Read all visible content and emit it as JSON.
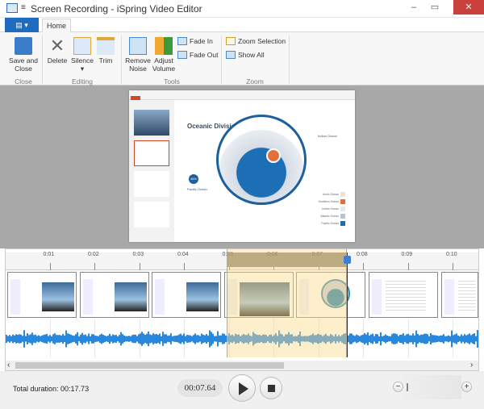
{
  "window": {
    "title": "Screen Recording - iSpring Video Editor",
    "minimize": "–",
    "maximize": "▭",
    "close": "✕",
    "close_color": "#c9403d"
  },
  "tabs": {
    "file_label": "▤ ▾",
    "home": "Home"
  },
  "ribbon": {
    "groups": [
      {
        "label": "Close",
        "buttons": [
          {
            "label": "Save and Close",
            "icon": "save-icon"
          }
        ]
      },
      {
        "label": "Editing",
        "buttons": [
          {
            "label": "Delete",
            "icon": "delete-icon"
          },
          {
            "label": "Silence",
            "icon": "silence-icon",
            "dropdown": "▾"
          },
          {
            "label": "Trim",
            "icon": "trim-icon"
          }
        ]
      },
      {
        "label": "Tools",
        "buttons": [
          {
            "label": "Remove Noise",
            "icon": "remove-noise-icon"
          },
          {
            "label": "Adjust Volume",
            "icon": "volume-icon"
          },
          {
            "label": "Fade In",
            "icon": "fade-in-icon"
          },
          {
            "label": "Fade Out",
            "icon": "fade-out-icon"
          }
        ]
      },
      {
        "label": "Zoom",
        "buttons": [
          {
            "label": "Zoom Selection",
            "icon": "zoom-selection-icon"
          },
          {
            "label": "Show All",
            "icon": "show-all-icon"
          }
        ]
      }
    ]
  },
  "preview": {
    "slide_title": "Oceanic Divisions",
    "callout_left": "Pacific Ocean",
    "callout_right": "Indian Ocean",
    "badge": "46%",
    "legend": [
      "Arctic Ocean",
      "Southern Ocean",
      "Indian Ocean",
      "Atlantic Ocean",
      "Pacific Ocean"
    ],
    "legend_colors": [
      "#f1e1cf",
      "#e2703e",
      "#e6e9ee",
      "#b9c4d2",
      "#1c6fb4"
    ]
  },
  "timeline": {
    "ticks": [
      "0:01",
      "0:02",
      "0:03",
      "0:04",
      "0:05",
      "0:06",
      "0:07",
      "0:08",
      "0:09",
      "0:10"
    ],
    "selection_start_sec": 4.95,
    "selection_end_sec": 7.64,
    "playhead_sec": 7.64,
    "waveform_color": "#2a88dc",
    "scroll_left": "‹",
    "scroll_right": "›",
    "scroll_position": 0.58
  },
  "footer": {
    "total_duration": "Total duration: 00:17.73",
    "current_time": "00:07.64",
    "zoom_out": "−",
    "zoom_in": "+"
  }
}
